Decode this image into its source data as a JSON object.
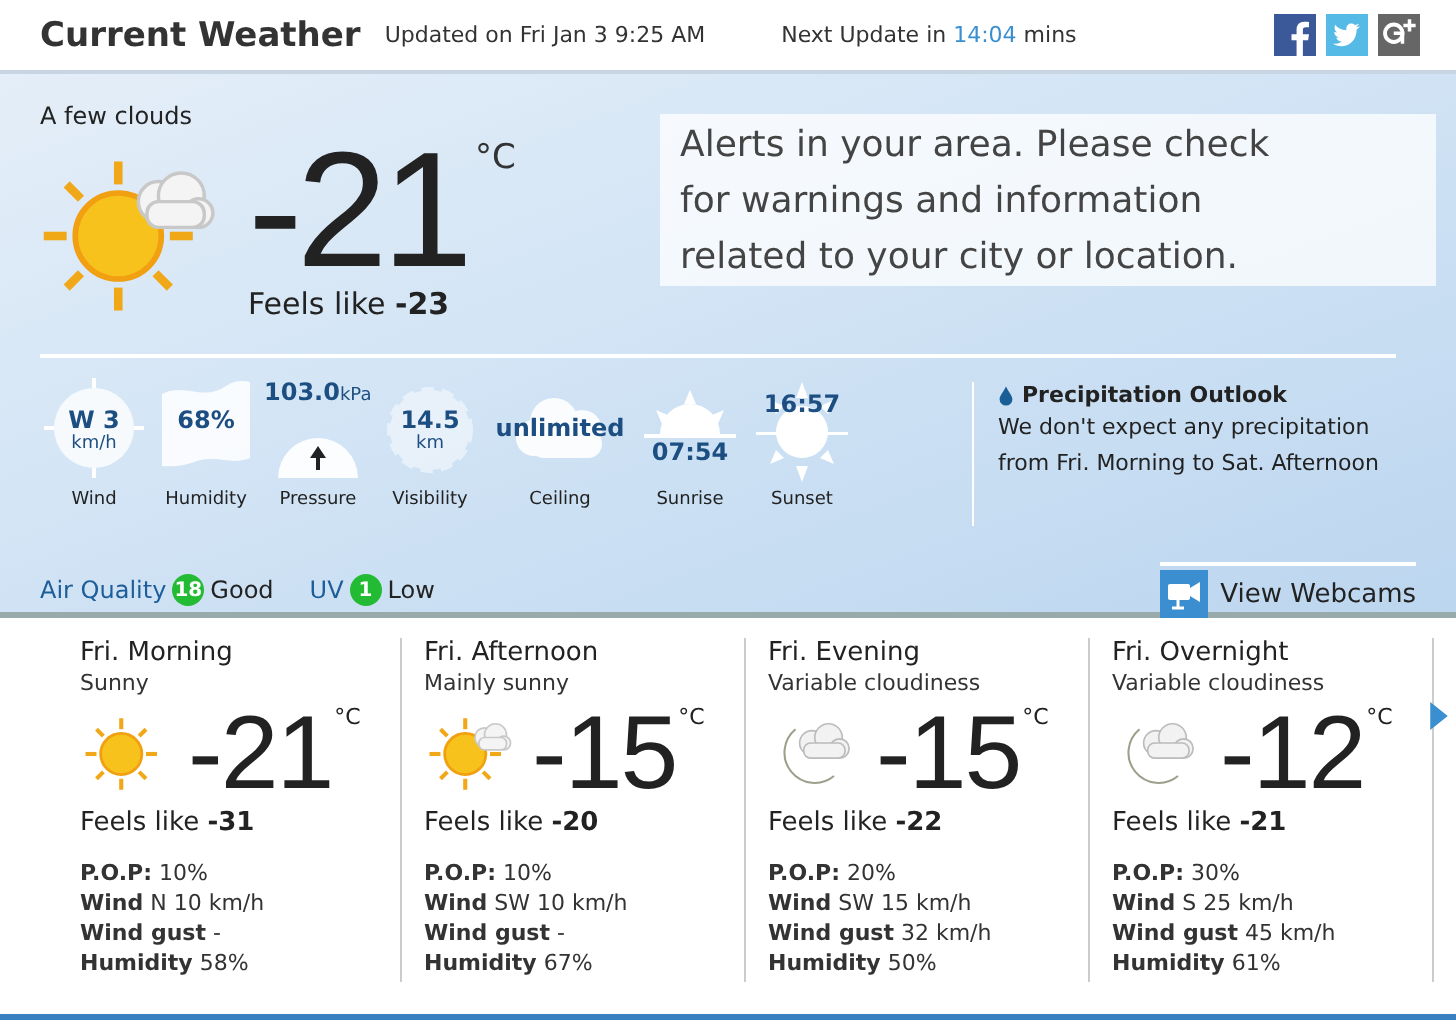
{
  "header": {
    "title": "Current Weather",
    "updated": "Updated on Fri Jan 3 9:25 AM",
    "next_update": {
      "label": "Next Update in",
      "time": "14:04",
      "unit": "mins"
    },
    "social": [
      {
        "kind": "facebook"
      },
      {
        "kind": "twitter"
      },
      {
        "kind": "googleplus"
      }
    ]
  },
  "current": {
    "condition": "A few clouds",
    "kind": "partly",
    "temp": "-21",
    "unit": "°C",
    "feels_like": "Feels like **-23**",
    "alert": "Alerts in your area. Please check for warnings and information related to your city or location."
  },
  "stats": [
    {
      "kind": "wind",
      "value": "W 3",
      "unit": "km/h",
      "label": "Wind"
    },
    {
      "kind": "humidity",
      "value": "68%",
      "label": "Humidity"
    },
    {
      "kind": "pressure",
      "value": "103.0",
      "unit": "kPa",
      "label": "Pressure"
    },
    {
      "kind": "visibility",
      "value": "14.5",
      "unit": "km",
      "label": "Visibility"
    },
    {
      "kind": "ceiling",
      "value": "unlimited",
      "label": "Ceiling"
    },
    {
      "kind": "sunrise",
      "value": "07:54",
      "label": "Sunrise"
    },
    {
      "kind": "sunset",
      "value": "16:57",
      "label": "Sunset"
    }
  ],
  "precipitation": {
    "title": "Precipitation Outlook",
    "text": "We don't expect any precipitation from Fri. Morning to Sat. Afternoon"
  },
  "indices": [
    {
      "label": "Air Quality",
      "value": "18",
      "rating": "Good",
      "color": "#22bb33"
    },
    {
      "label": "UV",
      "value": "1",
      "rating": "Low",
      "color": "#22bb33"
    }
  ],
  "webcams": {
    "label": "View Webcams"
  },
  "forecast": [
    {
      "period": "Fri. Morning",
      "condition": "Sunny",
      "kind": "sunny",
      "temp": "-21",
      "unit": "°C",
      "feels_like": "Feels like **-31**",
      "details": [
        "**P.O.P:** 10%",
        "**Wind** N 10 km/h",
        "**Wind gust** -",
        "**Humidity** 58%"
      ]
    },
    {
      "period": "Fri. Afternoon",
      "condition": "Mainly sunny",
      "kind": "partly",
      "temp": "-15",
      "unit": "°C",
      "feels_like": "Feels like **-20**",
      "details": [
        "**P.O.P:** 10%",
        "**Wind** SW 10 km/h",
        "**Wind gust** -",
        "**Humidity** 67%"
      ]
    },
    {
      "period": "Fri. Evening",
      "condition": "Variable cloudiness",
      "kind": "night-cloudy",
      "temp": "-15",
      "unit": "°C",
      "feels_like": "Feels like **-22**",
      "details": [
        "**P.O.P:** 20%",
        "**Wind** SW 15 km/h",
        "**Wind gust** 32 km/h",
        "**Humidity** 50%"
      ]
    },
    {
      "period": "Fri. Overnight",
      "condition": "Variable cloudiness",
      "kind": "night-cloudy",
      "temp": "-12",
      "unit": "°C",
      "feels_like": "Feels like **-21**",
      "details": [
        "**P.O.P:** 30%",
        "**Wind** S 25 km/h",
        "**Wind gust** 45 km/h",
        "**Humidity** 61%"
      ]
    }
  ]
}
